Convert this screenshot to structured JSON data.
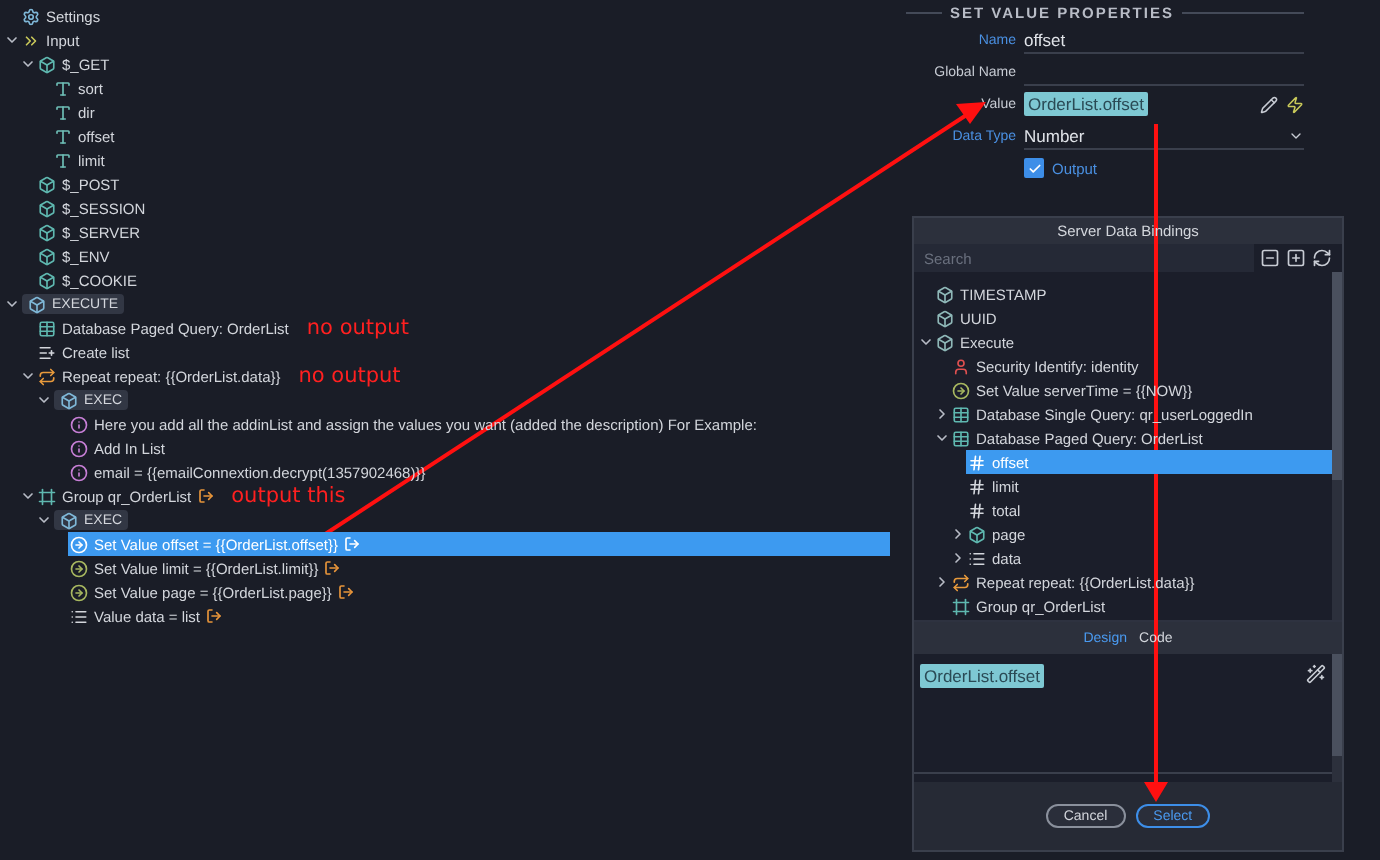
{
  "tree": [
    {
      "kind": "settings",
      "label": "Settings",
      "selected": false
    },
    {
      "kind": "input",
      "label": "Input",
      "expanded": true,
      "selected": false,
      "children": [
        {
          "kind": "object",
          "label": "$_GET",
          "expanded": true,
          "selected": false,
          "children": [
            {
              "kind": "string",
              "label": "sort",
              "selected": false
            },
            {
              "kind": "string",
              "label": "dir",
              "selected": false
            },
            {
              "kind": "string",
              "label": "offset",
              "selected": false
            },
            {
              "kind": "string",
              "label": "limit",
              "selected": false
            }
          ]
        },
        {
          "kind": "object",
          "label": "$_POST",
          "selected": false
        },
        {
          "kind": "object",
          "label": "$_SESSION",
          "selected": false
        },
        {
          "kind": "object",
          "label": "$_SERVER",
          "selected": false
        },
        {
          "kind": "object",
          "label": "$_ENV",
          "selected": false
        },
        {
          "kind": "object",
          "label": "$_COOKIE",
          "selected": false
        }
      ]
    },
    {
      "kind": "execute",
      "label": "EXECUTE",
      "expanded": true,
      "selected": false,
      "children": [
        {
          "kind": "query",
          "label": "Database Paged Query: OrderList",
          "note": "no output",
          "selected": false
        },
        {
          "kind": "list",
          "label": "Create list",
          "selected": false
        },
        {
          "kind": "repeat",
          "label": "Repeat repeat: {{OrderList.data}}",
          "note": "no output",
          "expanded": true,
          "selected": false,
          "children": [
            {
              "kind": "execute",
              "label": "EXEC",
              "expanded": true,
              "selected": false,
              "children": [
                {
                  "kind": "info",
                  "label": "Here you add all the addinList and assign the values you want (added the description) For Example:",
                  "selected": false
                },
                {
                  "kind": "info",
                  "label": "Add In List",
                  "selected": false
                },
                {
                  "kind": "info",
                  "label": "email = {{emailConnextion.decrypt(1357902468)}}",
                  "selected": false
                }
              ]
            }
          ]
        },
        {
          "kind": "group",
          "label": "Group qr_OrderList",
          "output": true,
          "note": "output this",
          "expanded": true,
          "selected": false,
          "children": [
            {
              "kind": "execute",
              "label": "EXEC",
              "expanded": true,
              "selected": false,
              "children": [
                {
                  "kind": "setvalue",
                  "label": "Set Value offset = {{OrderList.offset}}",
                  "output": true,
                  "selected": true
                },
                {
                  "kind": "setvalue",
                  "label": "Set Value limit = {{OrderList.limit}}",
                  "output": true,
                  "selected": false
                },
                {
                  "kind": "setvalue",
                  "label": "Set Value page = {{OrderList.page}}",
                  "output": true,
                  "selected": false
                },
                {
                  "kind": "value",
                  "label": "Value data = list",
                  "output": true,
                  "selected": false
                }
              ]
            }
          ]
        }
      ]
    }
  ],
  "properties": {
    "legend": "SET VALUE PROPERTIES",
    "fields": [
      {
        "kind": "text",
        "label": "Name",
        "highlighted": true,
        "value": "offset"
      },
      {
        "kind": "text",
        "label": "Global Name",
        "highlighted": false
      },
      {
        "kind": "token",
        "label": "Value",
        "highlighted": false,
        "value": "OrderList.offset"
      },
      {
        "kind": "select",
        "label": "Data Type",
        "highlighted": true,
        "value": "Number"
      },
      {
        "kind": "checkbox",
        "label": "Output",
        "checked": true
      }
    ]
  },
  "dialog": {
    "title": "Server Data Bindings",
    "search_placeholder": "Search",
    "tree": [
      {
        "kind": "field",
        "label": "TIMESTAMP",
        "selected": false
      },
      {
        "kind": "field",
        "label": "UUID",
        "selected": false
      },
      {
        "kind": "field",
        "label": "Execute",
        "expanded": true,
        "selected": false,
        "children": [
          {
            "kind": "security",
            "label": "Security Identify: identity",
            "selected": false
          },
          {
            "kind": "setvalue",
            "label": "Set Value serverTime = {{NOW}}",
            "selected": false
          },
          {
            "kind": "query",
            "label": "Database Single Query: qr_userLoggedIn",
            "expanded": false,
            "selected": false
          },
          {
            "kind": "query",
            "label": "Database Paged Query: OrderList",
            "expanded": true,
            "selected": false,
            "children": [
              {
                "kind": "number",
                "label": "offset",
                "selected": true
              },
              {
                "kind": "number",
                "label": "limit",
                "selected": false
              },
              {
                "kind": "number",
                "label": "total",
                "selected": false
              },
              {
                "kind": "object",
                "label": "page",
                "expanded": false,
                "selected": false
              },
              {
                "kind": "value",
                "label": "data",
                "expanded": false,
                "selected": false
              }
            ]
          },
          {
            "kind": "repeat",
            "label": "Repeat repeat: {{OrderList.data}}",
            "expanded": false,
            "selected": false
          },
          {
            "kind": "group",
            "label": "Group qr_OrderList",
            "selected": false
          }
        ]
      }
    ],
    "tabs": [
      {
        "label": "Design",
        "selected": true
      },
      {
        "label": "Code",
        "selected": false
      }
    ],
    "expression": "OrderList.offset",
    "buttons": [
      {
        "label": "Cancel",
        "kind": "secondary"
      },
      {
        "label": "Select",
        "kind": "primary"
      }
    ]
  }
}
